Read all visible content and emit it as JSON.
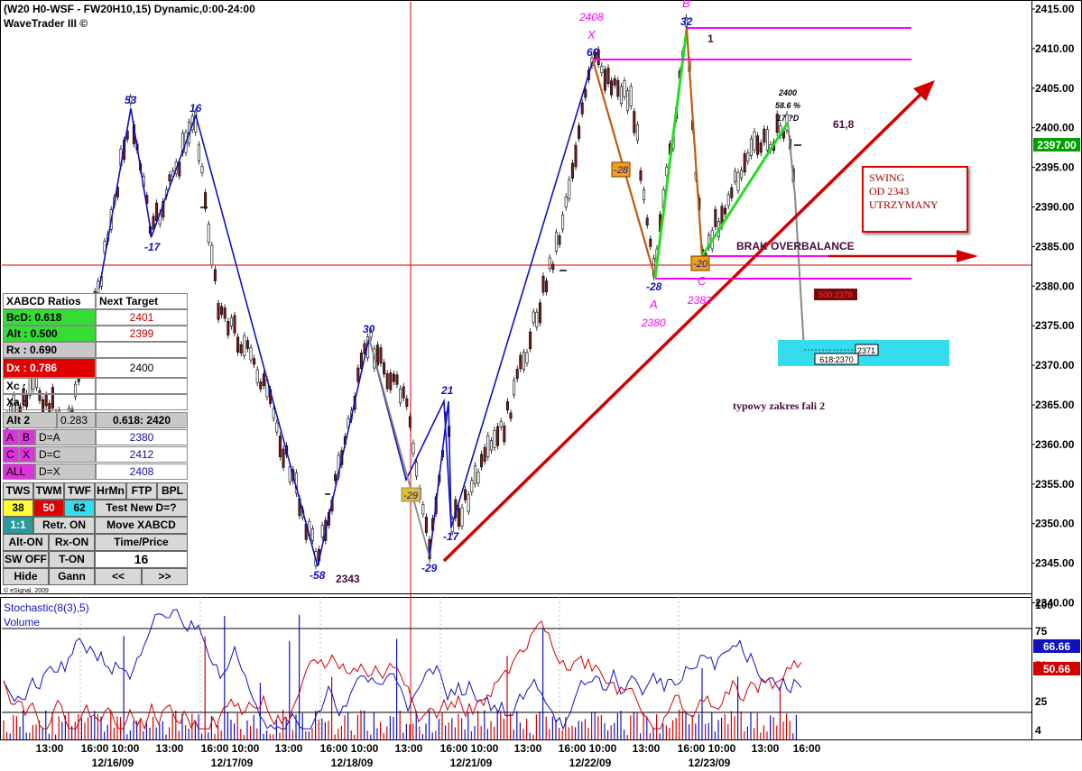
{
  "header": {
    "symbol_line": "(W20 H0-WSF - FW20H10,15) Dynamic,0:00-24:00",
    "app_name": "WaveTrader III ©"
  },
  "colors": {
    "blue_wave": "#1010c0",
    "red_trend": "#d40000",
    "magenta": "#ff00ff",
    "green": "#22dd22",
    "price_tag": "#00a000",
    "cyan_box": "#33ddee"
  },
  "price_axis": {
    "labels": [
      "2415.00",
      "2410.00",
      "2405.00",
      "2400.00",
      "2395.00",
      "2390.00",
      "2385.00",
      "2380.00",
      "2375.00",
      "2370.00",
      "2365.00",
      "2360.00",
      "2355.00",
      "2350.00",
      "2345.00",
      "2340.00"
    ],
    "current_price": "2397.00"
  },
  "stoch_axis": {
    "labels": [
      "100",
      "75",
      "50",
      "25",
      "4"
    ],
    "value_blue": "66.66",
    "value_red": "50.66"
  },
  "time_axis": {
    "times": [
      "13:00",
      "16:00 10:00",
      "13:00",
      "16:00 10:00",
      "13:00",
      "16:00 10:00",
      "13:00",
      "16:00 10:00",
      "13:00",
      "16:00 10:00",
      "13:00",
      "16:00 10:00",
      "13:00",
      "16:00"
    ],
    "dates": [
      "12/16/09",
      "12/17/09",
      "12/18/09",
      "12/21/09",
      "12/22/09",
      "12/23/09"
    ]
  },
  "wave_labels": {
    "p53": "53",
    "p16": "16",
    "m17a": "-17",
    "m58": "-58",
    "v2343": "2343",
    "p30": "30",
    "p21": "21",
    "m17b": "-17",
    "m29": "-29",
    "box29": "-29",
    "p60": "60",
    "X": "X",
    "v2408": "2408",
    "box28": "-28",
    "m28": "-28",
    "A": "A",
    "v2380": "2380",
    "p32": "32",
    "B": "B",
    "one": "1",
    "box20": "-20",
    "C": "C",
    "v2382": "2382",
    "d2400": "2400",
    "d586": "58.6 %",
    "d17D": "17 ?D",
    "r618": "61,8"
  },
  "annotations": {
    "swing_box": [
      "SWING",
      "OD 2343",
      "UTRZYMANY"
    ],
    "brak": "BRAK OVERBALANCE",
    "typowy": "typowy zakres fali 2",
    "dark_tag": "500:2378",
    "tag_2371": "2371",
    "tag_618": "618:2370"
  },
  "panel": {
    "title": "XABCD Ratios",
    "next_target": "Next Target",
    "rows": [
      {
        "k": "BcD:",
        "v": "0.618",
        "t": "2401"
      },
      {
        "k": "Alt :",
        "v": "0.500",
        "t": "2399"
      },
      {
        "k": "Rx  :",
        "v": "0.690",
        "t": ""
      },
      {
        "k": "Dx  :",
        "v": "0.786",
        "t": "2400"
      }
    ],
    "xc": "Xc :",
    "xa": "Xa :",
    "alt2": "Alt 2",
    "alt2_val": "0.283",
    "alt2_target": "0.618: 2420",
    "ab_row": {
      "a": "A",
      "b": "B",
      "d": "D=A",
      "t": "2380"
    },
    "cx_row": {
      "a": "C",
      "b": "X",
      "d": "D=C",
      "t": "2412"
    },
    "all_row": {
      "a": "ALL",
      "d": "D=X",
      "t": "2408"
    },
    "tabs": [
      "TWS",
      "TWM",
      "TWF",
      "HrMn",
      "FTP",
      "BPL"
    ],
    "tab_vals": [
      "38",
      "50",
      "62"
    ],
    "test_new": "Test New D=?",
    "ratio_btn": "1:1",
    "retr_on": "Retr. ON",
    "move_xabcd": "Move XABCD",
    "alt_on": "Alt-ON",
    "rx_on": "Rx-ON",
    "time_price": "Time/Price",
    "sw_off": "SW OFF",
    "t_on": "T-ON",
    "counter": "16",
    "hide": "Hide",
    "gann": "Gann",
    "prev": "<<",
    "next": ">>",
    "copyright": "© eSignal, 2009"
  },
  "indicator": {
    "name": "Stochastic(8(3),5)",
    "volume": "Volume"
  }
}
